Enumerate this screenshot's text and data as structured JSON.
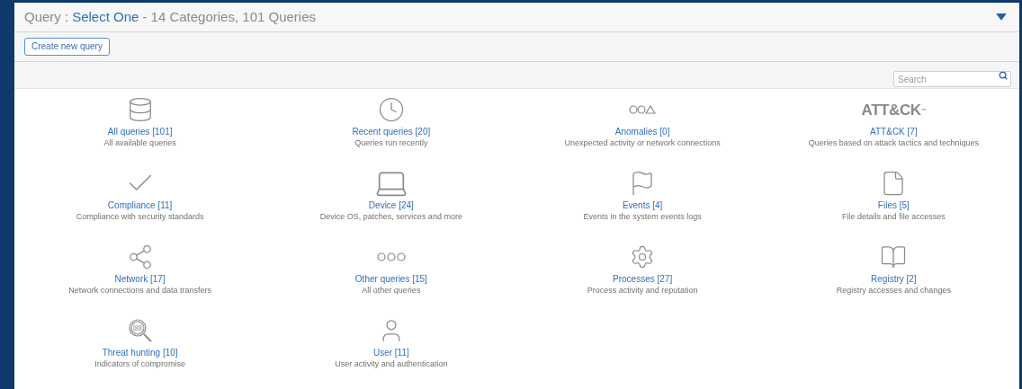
{
  "header": {
    "label": "Query :",
    "selection": "Select One",
    "summary": "- 14 Categories, 101 Queries",
    "expanded": true
  },
  "toolbar": {
    "create_button": "Create new query"
  },
  "search": {
    "placeholder": "Search"
  },
  "categories": [
    {
      "kind": "database",
      "title": "All queries [101]",
      "description": "All available queries"
    },
    {
      "kind": "clock",
      "title": "Recent queries [20]",
      "description": "Queries run recently"
    },
    {
      "kind": "anomalies",
      "title": "Anomalies [0]",
      "description": "Unexpected activity or network connections"
    },
    {
      "kind": "logo",
      "logo": "ATT&CK$^{™}$",
      "title": "ATT&CK [7]",
      "description": "Queries based on attack tactics and techniques"
    },
    {
      "kind": "check",
      "title": "Compliance [11]",
      "description": "Compliance with security standards"
    },
    {
      "kind": "laptop",
      "title": "Device [24]",
      "description": "Device OS, patches, services and more"
    },
    {
      "kind": "flag",
      "title": "Events [4]",
      "description": "Events in the system events logs"
    },
    {
      "kind": "file",
      "title": "Files [5]",
      "description": "File details and file accesses"
    },
    {
      "kind": "share",
      "title": "Network [17]",
      "description": "Network connections and data transfers"
    },
    {
      "kind": "dots",
      "title": "Other queries [15]",
      "description": "All other queries"
    },
    {
      "kind": "gear",
      "title": "Processes [27]",
      "description": "Process activity and reputation"
    },
    {
      "kind": "book",
      "title": "Registry [2]",
      "description": "Registry accesses and changes"
    },
    {
      "kind": "magnifier",
      "title": "Threat hunting [10]",
      "description": "Indicators of compromise"
    },
    {
      "kind": "user",
      "title": "User [11]",
      "description": "User activity and authentication"
    }
  ]
}
